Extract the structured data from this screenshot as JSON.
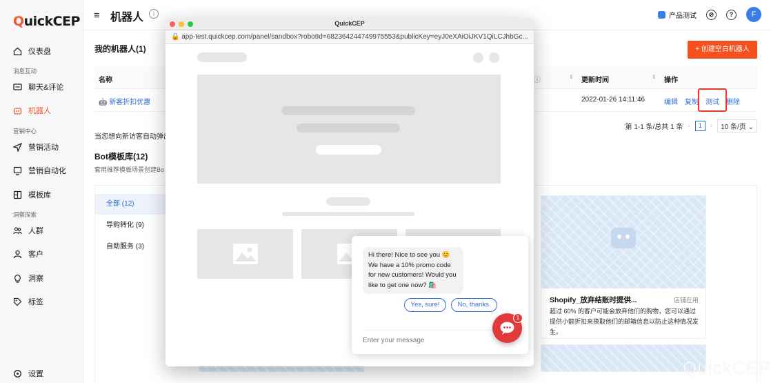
{
  "app": {
    "logo_q": "Q",
    "logo_rest": "uickCEP"
  },
  "sidebar": {
    "items": [
      {
        "label": "仪表盘",
        "icon": "home-icon"
      },
      {
        "label": "聊天&评论",
        "icon": "chat-icon"
      },
      {
        "label": "机器人",
        "icon": "robot-icon",
        "active": true
      },
      {
        "label": "营销活动",
        "icon": "send-icon"
      },
      {
        "label": "营销自动化",
        "icon": "automation-icon"
      },
      {
        "label": "模板库",
        "icon": "template-icon"
      },
      {
        "label": "人群",
        "icon": "group-icon"
      },
      {
        "label": "客户",
        "icon": "user-icon"
      },
      {
        "label": "洞察",
        "icon": "bulb-icon"
      },
      {
        "label": "标签",
        "icon": "tag-icon"
      },
      {
        "label": "设置",
        "icon": "gear-icon"
      }
    ],
    "sections": [
      "消息互动",
      "营销中心",
      "洞察探索"
    ]
  },
  "header": {
    "title": "机器人",
    "product_test": "产品测试",
    "avatar": "F"
  },
  "main": {
    "my_bots": "我的机器人(1)",
    "create_button": "+ 创建空白机器人",
    "columns": [
      "名称",
      "更新时间",
      "操作"
    ],
    "row": {
      "name": "新客折扣优惠",
      "updated": "2022-01-26 14:11:46",
      "actions": [
        "编辑",
        "复制",
        "测试",
        "删除"
      ]
    },
    "pager": {
      "summary": "第 1-1 条/总共 1 条",
      "page": "1",
      "page_size": "10 条/页"
    },
    "hint": "当您想向新访客自动弹出",
    "templates_title": "Bot模板库(12)",
    "templates_sub": "套用推荐模板场景创建Bo",
    "categories": [
      "全部 (12)",
      "导购转化 (9)",
      "自助服务 (3)"
    ],
    "card": {
      "title": "Shopify_放弃结账时提供...",
      "tag": "店铺在用",
      "desc": "超过 60% 的客户可能会放弃他们的购物，您可以通过提供小额折扣来换取他们的邮箱信息以防止这种情况发生。"
    },
    "watermark": "QuickCEP"
  },
  "sandbox": {
    "title": "QuickCEP",
    "url": "app-test.quickcep.com/panel/sandbox?robotId=682364244749975553&publicKey=eyJ0eXAiOiJKV1QiLCJhbGc...",
    "chat": {
      "message": "Hi there! Nice to see you 😊 We have a 10% promo code for new customers! Would you like to get one now? 🛍️",
      "reply_yes": "Yes, sure!",
      "reply_no": "No, thanks.",
      "input_placeholder": "Enter your message",
      "badge": "1"
    }
  }
}
